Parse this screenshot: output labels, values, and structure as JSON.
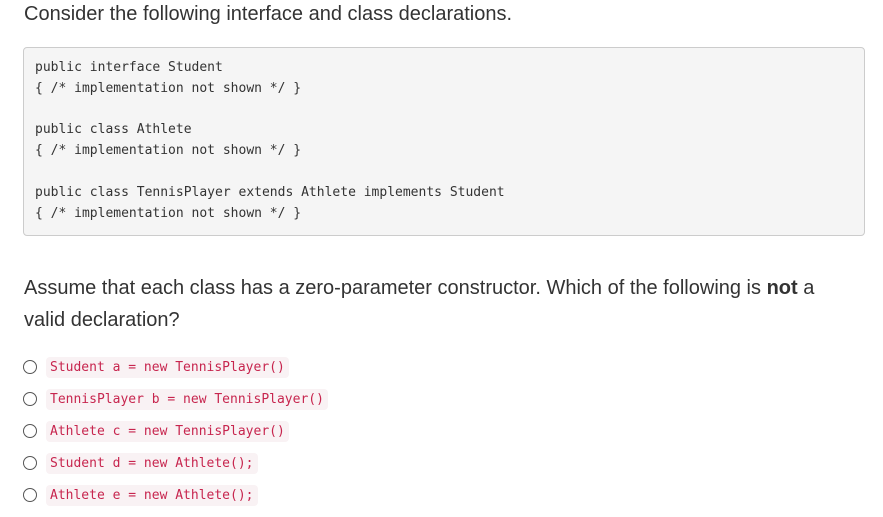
{
  "intro_text": "Consider the following interface and class declarations.",
  "code_block": {
    "groups": [
      [
        "public interface Student",
        "{ /* implementation not shown */ }"
      ],
      [
        "public class Athlete",
        "{ /* implementation not shown */ }"
      ],
      [
        "public class TennisPlayer extends Athlete implements Student",
        "{ /* implementation not shown */ }"
      ]
    ]
  },
  "question": {
    "before": "Assume that each class has a zero-parameter constructor. Which of the following is ",
    "emphasis": "not",
    "after": " a valid declaration?"
  },
  "options": [
    "Student a = new TennisPlayer()",
    "TennisPlayer b = new TennisPlayer()",
    "Athlete c = new TennisPlayer()",
    "Student d = new Athlete();",
    "Athlete e = new Athlete();"
  ],
  "colors": {
    "text": "#333333",
    "code_background": "#f5f5f5",
    "code_border": "#cccccc",
    "inline_code_text": "#c7254e",
    "inline_code_background": "#f9f2f4"
  }
}
